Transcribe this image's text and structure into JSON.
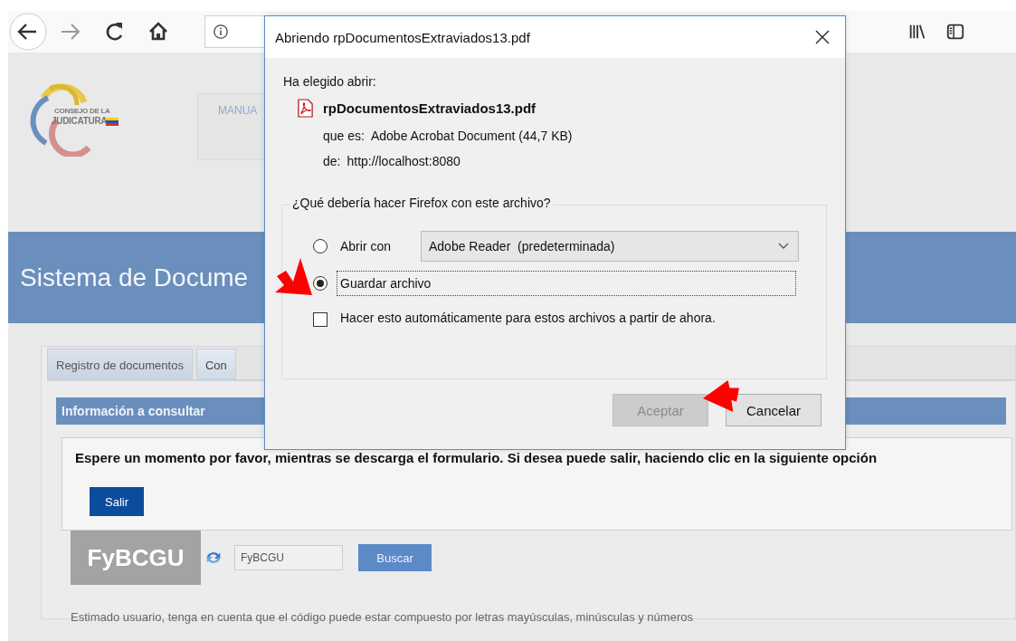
{
  "browser": {
    "nav_buttons": [
      {
        "kind": "back",
        "disabled": false
      },
      {
        "kind": "forward",
        "disabled": true
      },
      {
        "kind": "reload",
        "disabled": false
      },
      {
        "kind": "home",
        "disabled": false
      }
    ],
    "tool_buttons": [
      {
        "kind": "library"
      },
      {
        "kind": "sidebar"
      }
    ]
  },
  "page": {
    "logo": {
      "line_1": "CONSEJO DE LA",
      "line_2": "JUDICATURA"
    },
    "menu_item": "MANUA",
    "banner_title": "Sistema de Docume",
    "tabs": [
      {
        "label": "Registro de documentos",
        "selected": false
      },
      {
        "label": "Con",
        "selected": true
      }
    ],
    "section_title": "Información a consultar",
    "message": "Espere un momento por favor, mientras se descarga el formulario. Si desea puede salir, haciendo clic en la siguiente opción",
    "exit_button": "Salir",
    "captcha": {
      "code": "FyBCGU",
      "input_value": "FyBCGU",
      "search_button": "Buscar"
    },
    "note": "Estimado usuario, tenga en cuenta que el código puede estar compuesto por letras mayúsculas, minúsculas y números"
  },
  "dialog": {
    "title": "Abriendo rpDocumentosExtraviados13.pdf",
    "intro": "Ha elegido abrir:",
    "file_name": "rpDocumentosExtraviados13.pdf",
    "type_label": "que es:",
    "type_value": "Adobe Acrobat Document (44,7 KB)",
    "from_label": "de:",
    "from_value": "http://localhost:8080",
    "group_title": "¿Qué debería hacer Firefox con este archivo?",
    "options": [
      {
        "kind": "open_with",
        "label": "Abrir con",
        "selected": false,
        "app": "Adobe Reader  (predeterminada)"
      },
      {
        "kind": "save",
        "label": "Guardar archivo",
        "selected": true
      }
    ],
    "auto_checkbox": {
      "label": "Hacer esto automáticamente para estos archivos a partir de ahora.",
      "checked": false
    },
    "buttons": [
      {
        "label": "Aceptar",
        "disabled": true
      },
      {
        "label": "Cancelar",
        "disabled": false
      }
    ]
  }
}
